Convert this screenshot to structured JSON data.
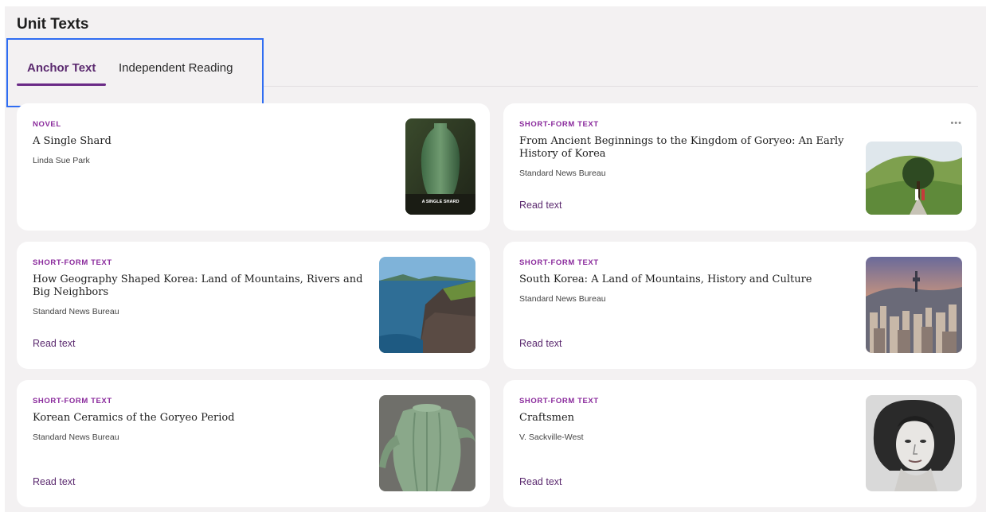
{
  "page": {
    "title": "Unit Texts"
  },
  "tabs": [
    {
      "label": "Anchor Text",
      "selected": true
    },
    {
      "label": "Independent Reading",
      "selected": false
    }
  ],
  "colors": {
    "accent": "#6a2a86",
    "category": "#8a2a9c",
    "highlight": "#2f6df2"
  },
  "cards": [
    {
      "category": "NOVEL",
      "title": "A Single Shard",
      "author": "Linda Sue Park",
      "read": "",
      "cover_text": "A SINGLE SHARD"
    },
    {
      "category": "SHORT-FORM TEXT",
      "title": "From Ancient Beginnings to the Kingdom of Goryeo: An Early History of Korea",
      "author": "Standard News Bureau",
      "read": "Read text"
    },
    {
      "category": "SHORT-FORM TEXT",
      "title": "How Geography Shaped Korea: Land of Mountains, Rivers and Big Neighbors",
      "author": "Standard News Bureau",
      "read": "Read text"
    },
    {
      "category": "SHORT-FORM TEXT",
      "title": "South Korea: A Land of Mountains, History and Culture",
      "author": "Standard News Bureau",
      "read": "Read text"
    },
    {
      "category": "SHORT-FORM TEXT",
      "title": "Korean Ceramics of the Goryeo Period",
      "author": "Standard News Bureau",
      "read": "Read text"
    },
    {
      "category": "SHORT-FORM TEXT",
      "title": "Craftsmen",
      "author": "V. Sackville-West",
      "read": "Read text"
    }
  ]
}
